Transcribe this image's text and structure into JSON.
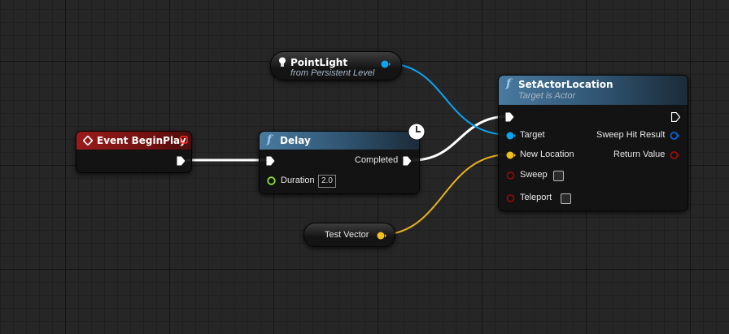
{
  "colors": {
    "exec_wire": "#ffffff",
    "object_pin": "#0aa4f0",
    "vector_pin": "#f2c01e",
    "bool_pin": "#8b0b0b",
    "event_header": "#8a1616",
    "function_header": "#3f6c8e"
  },
  "nodes": {
    "point_light": {
      "title": "PointLight",
      "subtitle": "from Persistent Level",
      "icon": "lightbulb-icon"
    },
    "begin_play": {
      "title": "Event BeginPlay",
      "icon": "event-diamond-icon"
    },
    "delay": {
      "title": "Delay",
      "icon": "function-icon",
      "completed_label": "Completed",
      "duration_label": "Duration",
      "duration_value": "2.0",
      "latent_icon": "clock-icon"
    },
    "set_actor_location": {
      "title": "SetActorLocation",
      "subtitle": "Target is Actor",
      "icon": "function-icon",
      "inputs": {
        "target": "Target",
        "new_location": "New Location",
        "sweep": "Sweep",
        "teleport": "Teleport"
      },
      "outputs": {
        "sweep_hit_result": "Sweep Hit Result",
        "return_value": "Return Value"
      },
      "sweep_checked": false,
      "teleport_checked": false
    },
    "test_vector": {
      "title": "Test Vector"
    }
  }
}
